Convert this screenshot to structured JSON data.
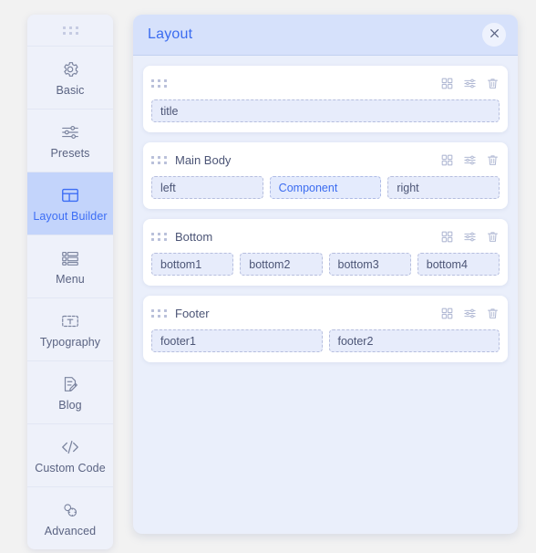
{
  "sidebar": {
    "handle_icon": "drag-dots-icon",
    "items": [
      {
        "label": "Basic",
        "icon": "gear-icon",
        "active": false
      },
      {
        "label": "Presets",
        "icon": "sliders-icon",
        "active": false
      },
      {
        "label": "Layout Builder",
        "icon": "layout-icon",
        "active": true
      },
      {
        "label": "Menu",
        "icon": "menu-list-icon",
        "active": false
      },
      {
        "label": "Typography",
        "icon": "typography-t-icon",
        "active": false
      },
      {
        "label": "Blog",
        "icon": "blog-pencil-icon",
        "active": false
      },
      {
        "label": "Custom Code",
        "icon": "code-brackets-icon",
        "active": false
      },
      {
        "label": "Advanced",
        "icon": "advanced-gear-icon",
        "active": false
      }
    ]
  },
  "panel": {
    "title": "Layout",
    "close_icon": "close-icon",
    "accent_color": "#3b6cf0",
    "header_bg": "#d6e1fb",
    "body_bg": "#eaeffb",
    "row_actions": [
      {
        "name": "grid-icon",
        "title": "Grid"
      },
      {
        "name": "sliders-icon",
        "title": "Settings"
      },
      {
        "name": "trash-icon",
        "title": "Delete"
      }
    ],
    "rows": [
      {
        "label": "",
        "handle_icon": "drag-dots-icon",
        "columns": [
          {
            "label": "title",
            "accent": false,
            "flex": 1
          }
        ]
      },
      {
        "label": "Main Body",
        "handle_icon": "drag-dots-icon",
        "columns": [
          {
            "label": "left",
            "accent": false,
            "flex": 1
          },
          {
            "label": "Component",
            "accent": true,
            "flex": 1
          },
          {
            "label": "right",
            "accent": false,
            "flex": 1
          }
        ]
      },
      {
        "label": "Bottom",
        "handle_icon": "drag-dots-icon",
        "columns": [
          {
            "label": "bottom1",
            "accent": false,
            "flex": 1
          },
          {
            "label": "bottom2",
            "accent": false,
            "flex": 1
          },
          {
            "label": "bottom3",
            "accent": false,
            "flex": 1
          },
          {
            "label": "bottom4",
            "accent": false,
            "flex": 1
          }
        ]
      },
      {
        "label": "Footer",
        "handle_icon": "drag-dots-icon",
        "columns": [
          {
            "label": "footer1",
            "accent": false,
            "flex": 1
          },
          {
            "label": "footer2",
            "accent": false,
            "flex": 1
          }
        ]
      }
    ]
  }
}
